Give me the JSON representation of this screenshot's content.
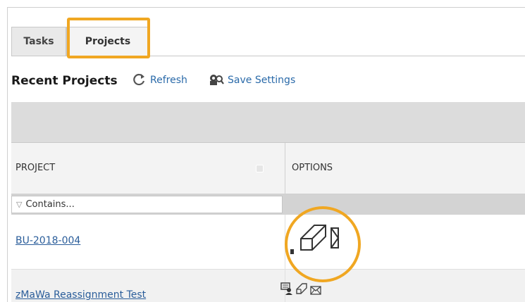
{
  "tabs": [
    {
      "label": "Tasks"
    },
    {
      "label": "Projects"
    }
  ],
  "toolbar": {
    "title": "Recent Projects",
    "refresh_label": "Refresh",
    "save_settings_label": "Save Settings"
  },
  "grid": {
    "columns": [
      "PROJECT",
      "OPTIONS"
    ],
    "filter_placeholder": "Contains...",
    "rows": [
      {
        "project": "BU-2018-004"
      },
      {
        "project": "zMaWa Reassignment Test"
      }
    ]
  },
  "colors": {
    "highlight": "#f0a722",
    "link": "#2a5d9a",
    "toolbar_link": "#2a6aa9",
    "group_bar": "#dcdcdc"
  },
  "icons": [
    "refresh-icon",
    "save-settings-icon",
    "filter-icon",
    "reassign-icon",
    "edit-tag-icon",
    "email-icon"
  ]
}
